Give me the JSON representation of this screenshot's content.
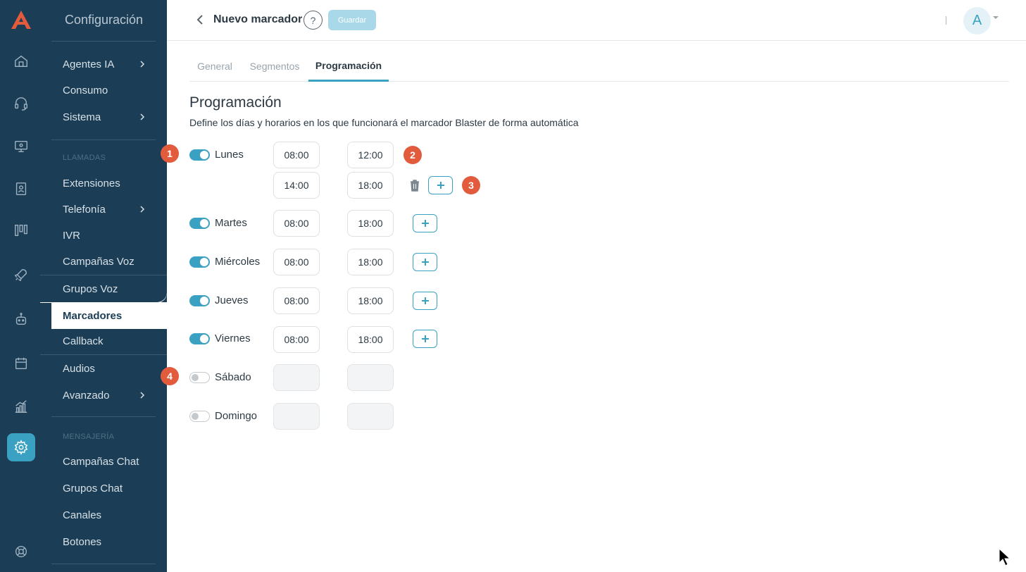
{
  "nav": {
    "title": "Configuración",
    "items_top": [
      {
        "label": "Agentes IA",
        "has_children": true
      },
      {
        "label": "Consumo",
        "has_children": false
      },
      {
        "label": "Sistema",
        "has_children": true
      }
    ],
    "section_calls": "LLAMADAS",
    "items_calls": [
      {
        "label": "Extensiones"
      },
      {
        "label": "Telefonía"
      },
      {
        "label": "IVR"
      },
      {
        "label": "Campañas Voz"
      },
      {
        "label": "Grupos Voz"
      },
      {
        "label": "Marcadores"
      },
      {
        "label": "Callback"
      },
      {
        "label": "Audios"
      },
      {
        "label": "Avanzado"
      }
    ],
    "section_messaging": "MENSAJERÍA",
    "items_messaging": [
      {
        "label": "Campañas Chat"
      },
      {
        "label": "Grupos Chat"
      },
      {
        "label": "Canales"
      },
      {
        "label": "Botones"
      }
    ],
    "active_item": "Marcadores"
  },
  "rail_icons": [
    "home-icon",
    "headset-icon",
    "monitor-icon",
    "contacts-icon",
    "board-icon",
    "rocket-icon",
    "robot-icon",
    "calendar-icon",
    "analytics-icon",
    "settings-icon",
    "support-icon"
  ],
  "header": {
    "title": "Nuevo marcador",
    "help_label": "?",
    "save_label": "Guardar",
    "avatar_initial": "A"
  },
  "tabs": [
    {
      "label": "General",
      "active": false
    },
    {
      "label": "Segmentos",
      "active": false
    },
    {
      "label": "Programación",
      "active": true
    }
  ],
  "schedule": {
    "title": "Programación",
    "description": "Define los días y horarios en los que funcionará el marcador Blaster de forma automática",
    "days": [
      {
        "name": "Lunes",
        "enabled": true,
        "ranges": [
          [
            "08:00",
            "12:00"
          ],
          [
            "14:00",
            "18:00"
          ]
        ]
      },
      {
        "name": "Martes",
        "enabled": true,
        "ranges": [
          [
            "08:00",
            "18:00"
          ]
        ]
      },
      {
        "name": "Miércoles",
        "enabled": true,
        "ranges": [
          [
            "08:00",
            "18:00"
          ]
        ]
      },
      {
        "name": "Jueves",
        "enabled": true,
        "ranges": [
          [
            "08:00",
            "18:00"
          ]
        ]
      },
      {
        "name": "Viernes",
        "enabled": true,
        "ranges": [
          [
            "08:00",
            "18:00"
          ]
        ]
      },
      {
        "name": "Sábado",
        "enabled": false,
        "ranges": [
          [
            "",
            ""
          ]
        ]
      },
      {
        "name": "Domingo",
        "enabled": false,
        "ranges": [
          [
            "",
            ""
          ]
        ]
      }
    ]
  },
  "annotations": [
    "1",
    "2",
    "3",
    "4"
  ],
  "colors": {
    "sidebar": "#1b3d55",
    "accent": "#3aa1c2",
    "badge": "#e25b3d",
    "save_disabled": "#a9d9e8"
  }
}
